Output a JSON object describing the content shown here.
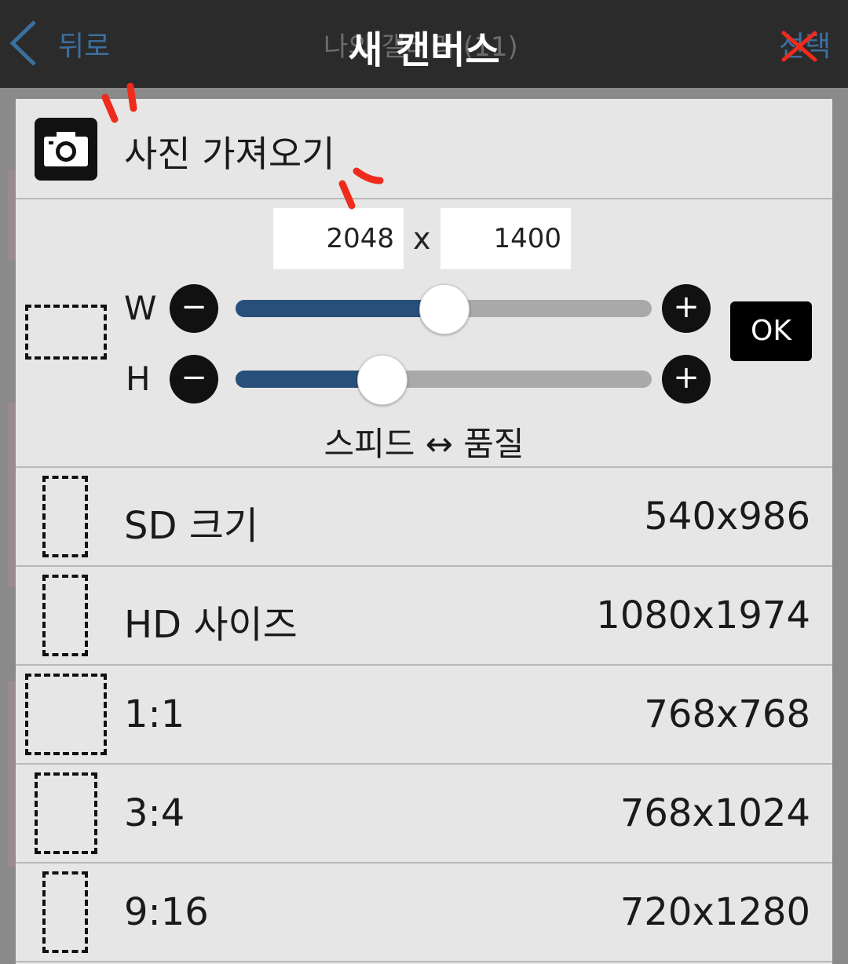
{
  "header": {
    "back_label": "뒤로",
    "bg_title": "나의 갤러리 (11)",
    "select_label": "선택",
    "dialog_title": "새 캔버스"
  },
  "import": {
    "label": "사진 가져오기"
  },
  "size": {
    "width": "2048",
    "height": "1400",
    "times": "x",
    "w_label": "W",
    "h_label": "H",
    "w_slider_level": 0.5,
    "h_slider_level": 0.35,
    "minus": "−",
    "plus": "+",
    "ok_label": "OK",
    "speed_quality_label": "스피드 ↔ 품질"
  },
  "presets": [
    {
      "name": "SD 크기",
      "size": "540x986"
    },
    {
      "name": "HD 사이즈",
      "size": "1080x1974"
    },
    {
      "name": "1:1",
      "size": "768x768"
    },
    {
      "name": "3:4",
      "size": "768x1024"
    },
    {
      "name": "9:16",
      "size": "720x1280"
    }
  ],
  "colors": {
    "header_bg": "#2b2b2b",
    "dialog_bg": "#e6e6e6",
    "slider_fill": "#284f7a",
    "link_blue": "#3b6f9e",
    "annotation_red": "#ef2b1c"
  }
}
